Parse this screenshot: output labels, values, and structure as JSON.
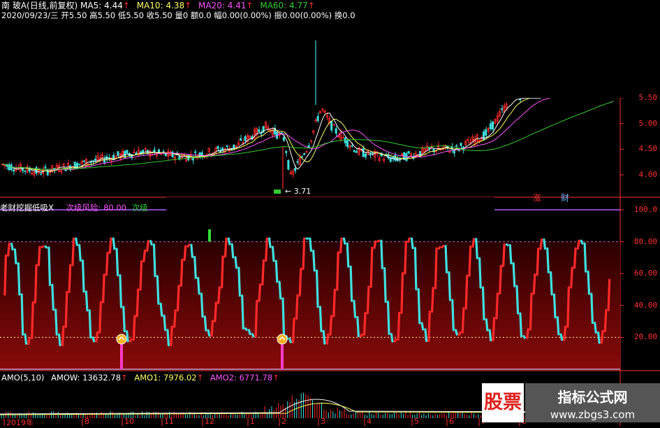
{
  "colors": {
    "background": "#000000",
    "up": "#ff2a2a",
    "down": "#3fe0e0",
    "ma5": "#ffffff",
    "ma10": "#ffff66",
    "ma20": "#ff55ff",
    "ma60": "#33cc33",
    "axis": "#ff3030",
    "indicator_line": "#b060ff",
    "pink": "#ff3cc8"
  },
  "header": {
    "name": "南 玻A",
    "mode": "(日线,前复权)",
    "ma5_label": "MA5:",
    "ma5_value": "4.44",
    "ma10_label": "MA10:",
    "ma10_value": "4.38",
    "ma20_label": "MA20:",
    "ma20_value": "4.41",
    "ma60_label": "MA60:",
    "ma60_value": "4.77",
    "arrow": "↑",
    "quote": "2020/09/23/三 开5.50 高5.50 低5.50 收5.50 量0 额0.0 幅0.00(0.00%) 振0.00(0.00%) 换0.0"
  },
  "price_axis": [
    "5.50",
    "5.00",
    "4.50",
    "4.00"
  ],
  "price_chart": {
    "low_marker": "3.71",
    "candles": [],
    "ma5": [],
    "ma10": [],
    "ma20": [],
    "ma60": []
  },
  "indicator": {
    "title": "老财挖掘低吸X",
    "risk_label": "次级风险: 80.00",
    "extra_label": "次级",
    "tags": [
      "涨",
      "财"
    ],
    "axis": [
      "100.0",
      "80.00",
      "60.00",
      "40.00",
      "20.00"
    ]
  },
  "amo": {
    "title": "AMO(5,10)",
    "amow_label": "AMOW:",
    "amow_value": "13632.78",
    "amo1_label": "AMO1:",
    "amo1_value": "7976.02",
    "amo2_label": "AMO2:",
    "amo2_value": "6771.78",
    "arrow": "↑"
  },
  "date_axis": [
    "2019年",
    "8",
    "10",
    "11",
    "12",
    "1",
    "2",
    "3",
    "4",
    "5",
    "6",
    "7",
    "8"
  ],
  "watermark": {
    "left": "股票",
    "right": "指标公式网",
    "url": "www.zbgs3.com"
  }
}
